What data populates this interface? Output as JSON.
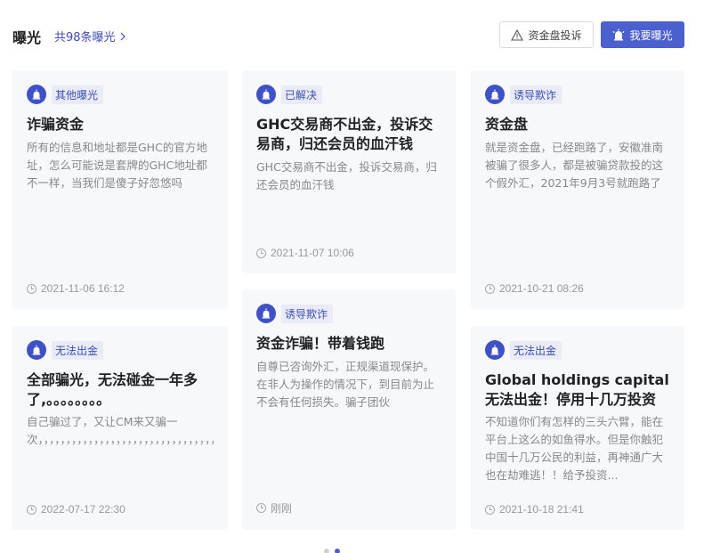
{
  "header": {
    "title": "曝光",
    "count_link": "共98条曝光",
    "complain_button": "资金盘投诉",
    "expose_button": "我要曝光"
  },
  "cards": [
    {
      "tag": "其他曝光",
      "title": "诈骗资金",
      "desc": "所有的信息和地址都是GHC的官方地址，怎么可能说是套牌的GHC地址都不一样，当我们是傻子好忽悠吗",
      "time": "2021-11-06 16:12"
    },
    {
      "tag": "已解决",
      "title": "GHC交易商不出金，投诉交易商，归还会员的血汗钱",
      "desc": "GHC交易商不出金，投诉交易商，归还会员的血汗钱",
      "time": "2021-11-07 10:06"
    },
    {
      "tag": "诱导欺诈",
      "title": "资金盘",
      "desc": "就是资金盘，已经跑路了，安徽准南被骗了很多人，都是被骗贷款投的这个假外汇，2021年9月3号就跑路了",
      "time": "2021-10-21 08:26"
    },
    {
      "tag": "无法出金",
      "title": "全部骗光，无法碰金一年多了,。。。。。。。。",
      "desc": "自己骗过了，又让CM来又骗一次，，，，，，，，，，，，，，，，，，，，，，，，，，，，，，，，，，，，，，，，，，，，，，…",
      "time": "2022-07-17 22:30"
    },
    {
      "tag": "诱导欺诈",
      "title": "资金诈骗！带着钱跑",
      "desc": "自尊已咨询外汇，正规渠道现保护。在非人为操作的情况下，到目前为止不会有任何损失。骗子团伙",
      "time": "刚刚"
    },
    {
      "tag": "无法出金",
      "title": "Global holdings capital无法出金！停用十几万投资者...",
      "desc": "不知道你们有怎样的三头六臂，能在平台上这么的如鱼得水。但是你触犯中国十几万公民的利益，再神通广大也在劫难逃！！给予投资...",
      "time": "2021-10-18 21:41"
    }
  ],
  "colors": {
    "accent": "#4b5fcf",
    "tag_bg": "#e9ebf7",
    "card_bg": "#f7f8fa"
  },
  "pagination": {
    "total": 2,
    "active": 2
  }
}
